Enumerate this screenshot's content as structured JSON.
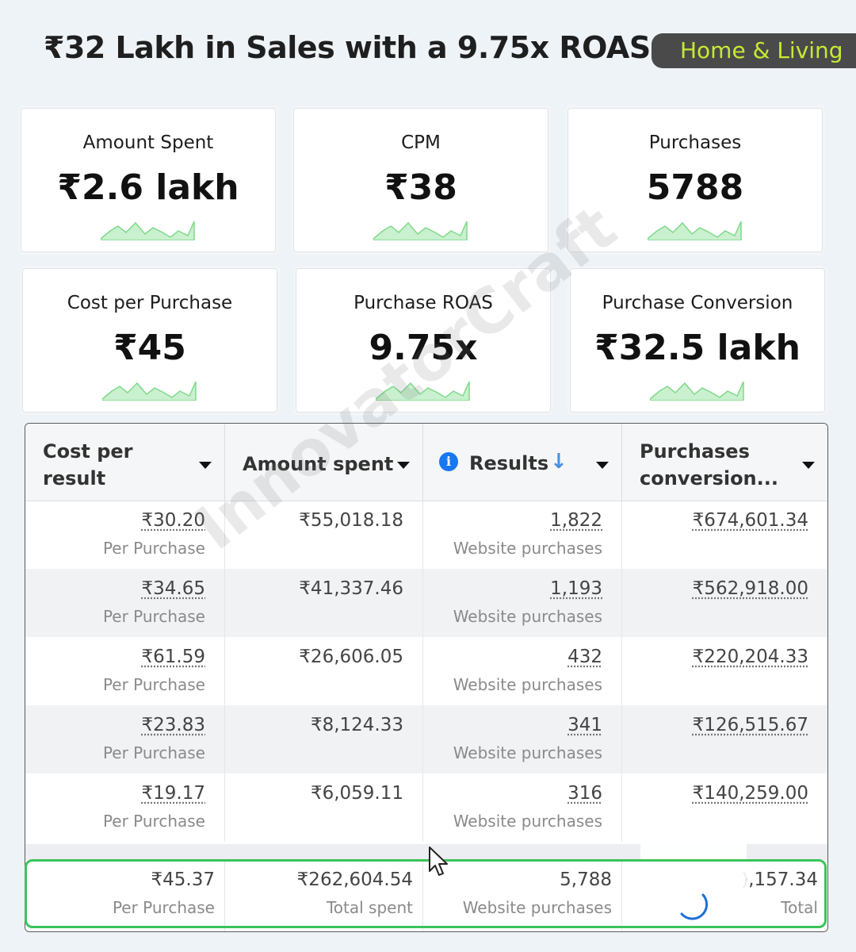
{
  "headline": "₹32 Lakh in Sales with a 9.75x ROAS",
  "category_tag": "Home & Living",
  "cards": [
    {
      "label": "Amount Spent",
      "value": "₹2.6 lakh"
    },
    {
      "label": "CPM",
      "value": "₹38"
    },
    {
      "label": "Purchases",
      "value": "5788"
    },
    {
      "label": "Cost per Purchase",
      "value": "₹45"
    },
    {
      "label": "Purchase ROAS",
      "value": "9.75x"
    },
    {
      "label": "Purchase Conversion",
      "value": "₹32.5 lakh"
    }
  ],
  "table": {
    "headers": [
      {
        "line1": "Cost per",
        "line2": "result"
      },
      {
        "line1": "Amount spent"
      },
      {
        "line1": "Results",
        "sort_icon": "arrow-down-icon",
        "info_icon": "info-icon"
      },
      {
        "line1": "Purchases",
        "line2": "conversion..."
      }
    ],
    "rows": [
      {
        "cost": "₹30.20",
        "cost_sub": "Per Purchase",
        "spent": "₹55,018.18",
        "results": "1,822",
        "results_sub": "Website purchases",
        "conv": "₹674,601.34"
      },
      {
        "cost": "₹34.65",
        "cost_sub": "Per Purchase",
        "spent": "₹41,337.46",
        "results": "1,193",
        "results_sub": "Website purchases",
        "conv": "₹562,918.00"
      },
      {
        "cost": "₹61.59",
        "cost_sub": "Per Purchase",
        "spent": "₹26,606.05",
        "results": "432",
        "results_sub": "Website purchases",
        "conv": "₹220,204.33"
      },
      {
        "cost": "₹23.83",
        "cost_sub": "Per Purchase",
        "spent": "₹8,124.33",
        "results": "341",
        "results_sub": "Website purchases",
        "conv": "₹126,515.67"
      },
      {
        "cost": "₹19.17",
        "cost_sub": "Per Purchase",
        "spent": "₹6,059.11",
        "results": "316",
        "results_sub": "Website purchases",
        "conv": "₹140,259.00"
      }
    ],
    "totals": {
      "cost": "₹45.37",
      "cost_sub": "Per Purchase",
      "spent": "₹262,604.54",
      "spent_sub": "Total spent",
      "results": "5,788",
      "results_sub": "Website purchases",
      "conv": "),157.34",
      "conv_sub": "Total"
    }
  },
  "watermark": "InnovatorCraft",
  "colors": {
    "accent_tag": "#c5ea34",
    "highlight": "#3cc35a",
    "sparkline": "#7fd98a",
    "info": "#1877f2"
  }
}
